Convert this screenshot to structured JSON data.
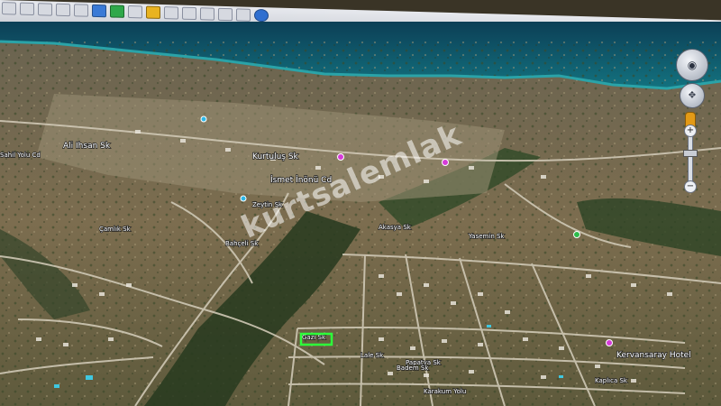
{
  "toolbar": {
    "icons": [
      "select-tool-icon",
      "hand-tool-icon",
      "placemark-icon",
      "polygon-icon",
      "path-icon",
      "overlay-icon",
      "tour-icon",
      "history-icon",
      "sun-icon",
      "planets-icon",
      "ruler-icon",
      "email-icon",
      "print-icon",
      "save-image-icon",
      "view-in-maps-icon"
    ]
  },
  "window": {
    "minimize": "–",
    "maximize": "□",
    "close": "×"
  },
  "watermark": "kurtsalemlak",
  "map_labels": [
    "Ali Ihsan Sk",
    "Kurtuluş Sk",
    "İsmet İnönü Cd",
    "Zeytin Sk",
    "Sahil Yolu Cd",
    "Çamlık Sk",
    "Bahçeli Sk",
    "Akasya Sk",
    "Gazi Sk",
    "Lale Sk",
    "Papatya Sk",
    "Yasemin Sk",
    "Kervansaray Hotel",
    "Badem Sk",
    "Karakum Yolu",
    "Kaplıca Sk"
  ],
  "selected_parcel": "parcel-highlight",
  "nav": {
    "zoom_in": "+",
    "zoom_out": "−"
  },
  "colors": {
    "sea": "#0f5e73",
    "coast": "#1f8a95",
    "land": "#7a6a4c",
    "roads": "#c9c2b0",
    "highlight": "#2dff3a",
    "pin": "#d63ad8"
  }
}
